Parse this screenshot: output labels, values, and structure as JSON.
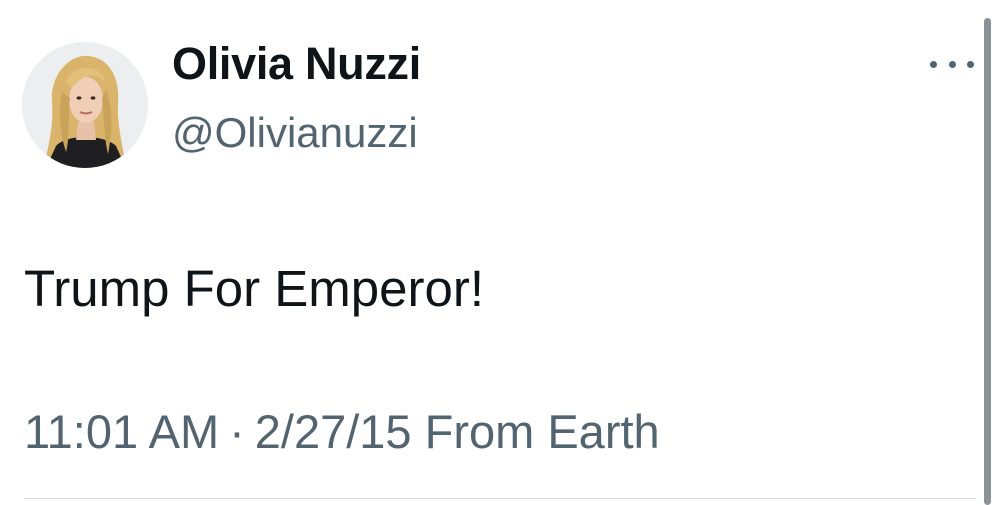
{
  "tweet": {
    "author": {
      "display_name": "Olivia Nuzzi",
      "handle": "@Olivianuzzi",
      "avatar_icon": "profile-photo"
    },
    "more_icon": "more-horizontal-icon",
    "text": "Trump For Emperor!",
    "time": "11:01 AM",
    "separator": "·",
    "date": "2/27/15",
    "source": "From Earth"
  },
  "colors": {
    "text_primary": "#0f1419",
    "text_secondary": "#536471",
    "divider": "#d7dee2"
  }
}
